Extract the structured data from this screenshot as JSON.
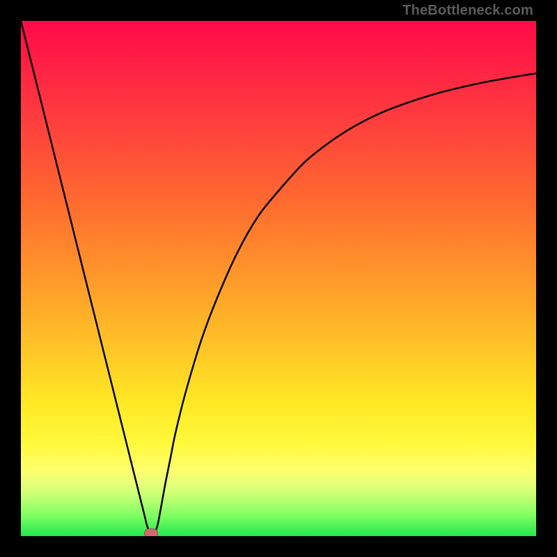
{
  "watermark": "TheBottleneck.com",
  "chart_data": {
    "type": "line",
    "title": "",
    "xlabel": "",
    "ylabel": "",
    "x": [
      0,
      2.5,
      5,
      7.5,
      10,
      12.5,
      15,
      17.5,
      20,
      21,
      22,
      23,
      24,
      24.5,
      25,
      25.5,
      26,
      26.5,
      27,
      28,
      29,
      30,
      32,
      35,
      38,
      42,
      46,
      50,
      55,
      60,
      65,
      70,
      75,
      80,
      85,
      90,
      95,
      100
    ],
    "y": [
      100,
      90,
      80,
      70,
      60,
      50,
      40,
      30,
      20,
      16,
      12,
      8,
      4,
      2,
      0.8,
      0.5,
      0.8,
      2,
      4.5,
      10,
      15,
      20,
      28,
      38,
      46,
      55,
      62,
      67,
      72.5,
      76.5,
      79.7,
      82.2,
      84.1,
      85.7,
      87,
      88.1,
      89,
      89.8
    ],
    "xlim": [
      0,
      100
    ],
    "ylim": [
      0,
      100
    ],
    "series_color": "#000000",
    "marker": {
      "x": 25.3,
      "y": 0.5,
      "color": "#d26b6e"
    },
    "background_gradient": {
      "direction": "vertical",
      "stops": [
        {
          "pos": 0.0,
          "color": "#ff0b48"
        },
        {
          "pos": 0.5,
          "color": "#ff992a"
        },
        {
          "pos": 0.82,
          "color": "#fff93c"
        },
        {
          "pos": 1.0,
          "color": "#22e74e"
        }
      ]
    }
  }
}
